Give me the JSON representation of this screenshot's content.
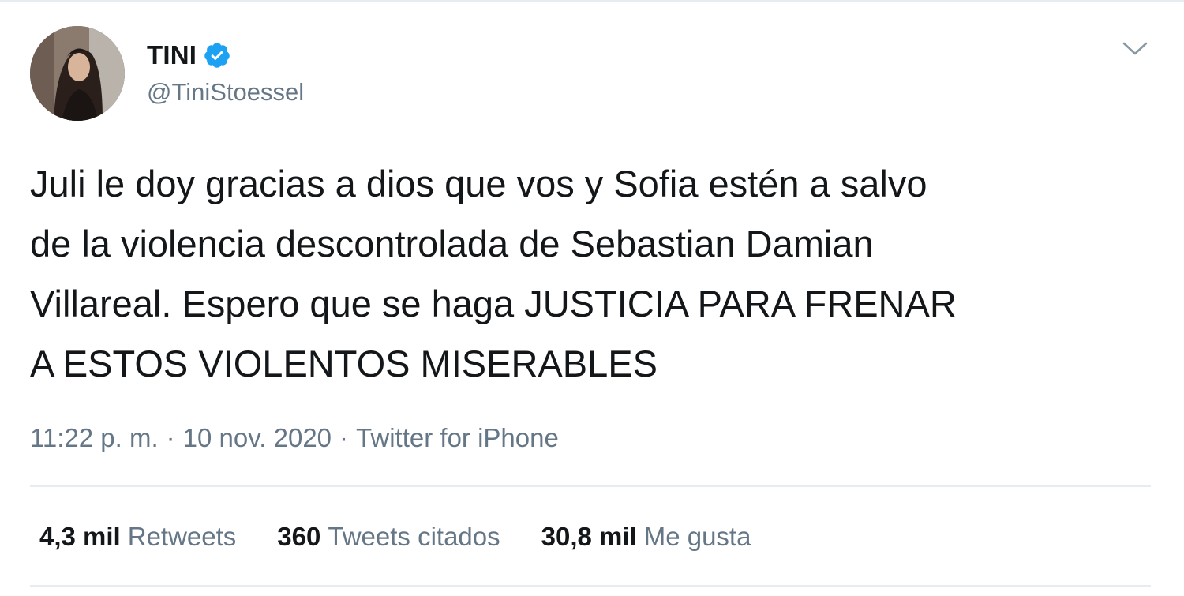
{
  "colors": {
    "text": "#14171a",
    "secondary": "#657786",
    "verified": "#1da1f2",
    "divider": "#e6ecf0"
  },
  "author": {
    "name": "TINI",
    "handle": "@TiniStoessel",
    "verified": true,
    "avatar_icon": "profile-photo"
  },
  "tweet": {
    "text": "Juli le doy gracias a dios que vos y Sofia estén a salvo\nde la violencia descontrolada de Sebastian Damian\nVillareal. Espero que se haga JUSTICIA PARA FRENAR\nA ESTOS VIOLENTOS MISERABLES"
  },
  "meta": {
    "time": "11:22 p. m.",
    "separator": "·",
    "date": "10 nov. 2020",
    "source": "Twitter for iPhone"
  },
  "stats": {
    "retweets": {
      "count": "4,3 mil",
      "label": "Retweets"
    },
    "quotes": {
      "count": "360",
      "label": "Tweets citados"
    },
    "likes": {
      "count": "30,8 mil",
      "label": "Me gusta"
    }
  },
  "icons": {
    "verified": "verified-badge-icon",
    "menu": "chevron-down-icon"
  }
}
